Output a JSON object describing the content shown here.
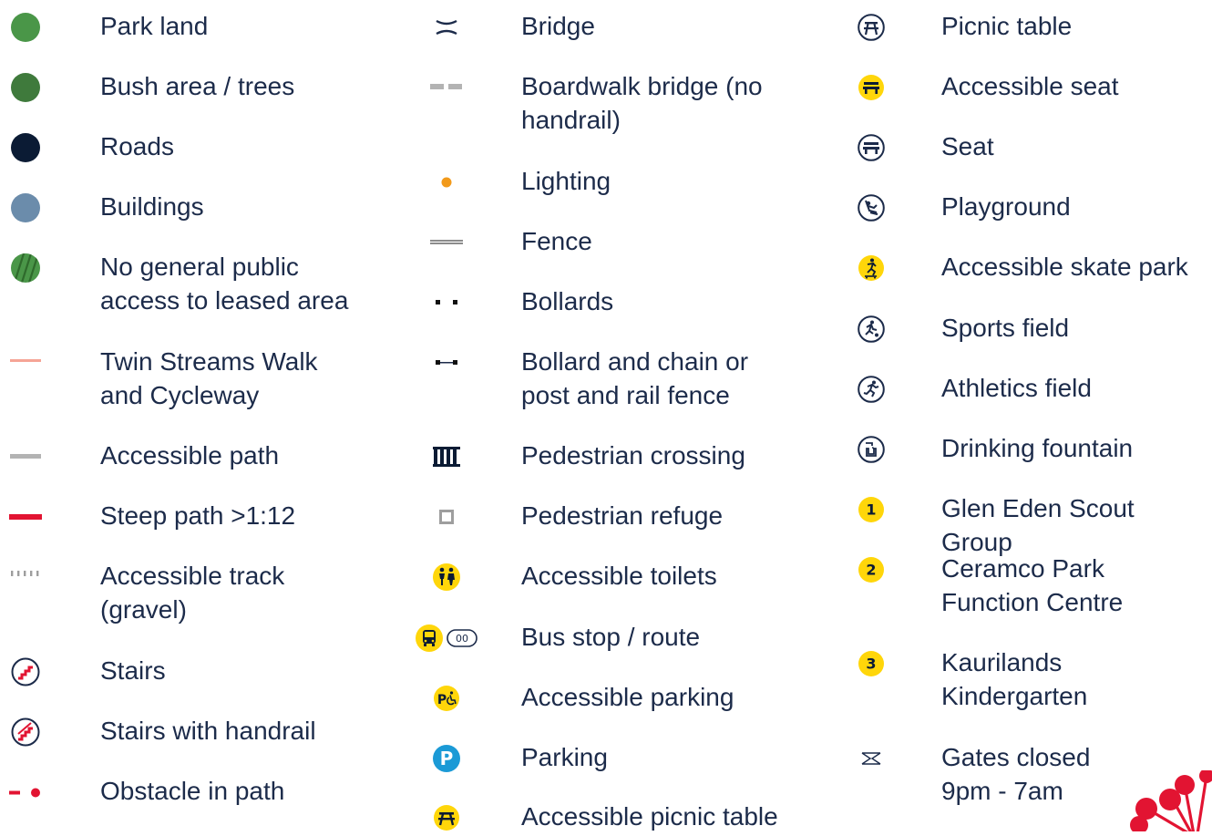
{
  "legend": {
    "columns": [
      {
        "items": [
          {
            "label": "Park land",
            "icon": "park-land-swatch",
            "color": "#4a9648"
          },
          {
            "label": "Bush area / trees",
            "icon": "bush-area-swatch",
            "color": "#3f7a3c"
          },
          {
            "label": "Roads",
            "icon": "roads-swatch",
            "color": "#0b1b34"
          },
          {
            "label": "Buildings",
            "icon": "buildings-swatch",
            "color": "#6b8cab"
          },
          {
            "label": "No general public\naccess to leased area",
            "icon": "leased-area-hatch-swatch",
            "color": "#3f8a3a"
          },
          {
            "label": "Twin Streams Walk\nand Cycleway",
            "icon": "cycleway-line",
            "color": "#f5a496"
          },
          {
            "label": "Accessible path",
            "icon": "accessible-path-line",
            "color": "#b3b3b3"
          },
          {
            "label": "Steep path >1:12",
            "icon": "steep-path-line",
            "color": "#e21432"
          },
          {
            "label": "Accessible track\n(gravel)",
            "icon": "gravel-track-line",
            "color": "#9e9e9e"
          },
          {
            "label": "Stairs",
            "icon": "stairs-icon",
            "color": "#e21432"
          },
          {
            "label": "Stairs with handrail",
            "icon": "stairs-handrail-icon",
            "color": "#e21432"
          },
          {
            "label": "Obstacle in path",
            "icon": "obstacle-icon",
            "color": "#e21432"
          }
        ]
      },
      {
        "items": [
          {
            "label": "Bridge",
            "icon": "bridge-icon",
            "color": "#1c2b4a"
          },
          {
            "label": "Boardwalk bridge (no\nhandrail)",
            "icon": "boardwalk-bridge-icon",
            "color": "#b3b3b3"
          },
          {
            "label": "Lighting",
            "icon": "lighting-dot",
            "color": "#f29a1a"
          },
          {
            "label": "Fence",
            "icon": "fence-line",
            "color": "#8c8c8c"
          },
          {
            "label": "Bollards",
            "icon": "bollards-icon",
            "color": "#111111"
          },
          {
            "label": "Bollard and chain or\npost and rail fence",
            "icon": "bollard-chain-icon",
            "color": "#1c2b4a"
          },
          {
            "label": "Pedestrian crossing",
            "icon": "pedestrian-crossing-icon",
            "color": "#0b1b34"
          },
          {
            "label": "Pedestrian refuge",
            "icon": "pedestrian-refuge-icon",
            "color": "#9e9e9e"
          },
          {
            "label": "Accessible toilets",
            "icon": "accessible-toilets-icon",
            "color": "#ffd60a"
          },
          {
            "label": "Bus stop / route",
            "icon": "bus-stop-icon",
            "color": "#ffd60a",
            "route_text": "00"
          },
          {
            "label": "Accessible parking",
            "icon": "accessible-parking-icon",
            "color": "#ffd60a",
            "badge_text": "P"
          },
          {
            "label": "Parking",
            "icon": "parking-icon",
            "color": "#1b9ad6",
            "badge_text": "P"
          },
          {
            "label": "Accessible picnic table",
            "icon": "accessible-picnic-table-icon",
            "color": "#ffd60a"
          }
        ]
      },
      {
        "items": [
          {
            "label": "Picnic table",
            "icon": "picnic-table-icon",
            "color": "#1c2b4a"
          },
          {
            "label": "Accessible seat",
            "icon": "accessible-seat-icon",
            "color": "#ffd60a"
          },
          {
            "label": "Seat",
            "icon": "seat-icon",
            "color": "#1c2b4a"
          },
          {
            "label": "Playground",
            "icon": "playground-icon",
            "color": "#1c2b4a"
          },
          {
            "label": "Accessible skate park",
            "icon": "accessible-skate-park-icon",
            "color": "#ffd60a"
          },
          {
            "label": "Sports field",
            "icon": "sports-field-icon",
            "color": "#1c2b4a"
          },
          {
            "label": "Athletics field",
            "icon": "athletics-field-icon",
            "color": "#1c2b4a"
          },
          {
            "label": "Drinking fountain",
            "icon": "drinking-fountain-icon",
            "color": "#1c2b4a"
          },
          {
            "label": "Glen Eden Scout Group",
            "icon": "number-badge-1",
            "color": "#ffd60a",
            "badge_text": "1"
          },
          {
            "label": "Ceramco Park\nFunction Centre",
            "icon": "number-badge-2",
            "color": "#ffd60a",
            "badge_text": "2"
          },
          {
            "label": "Kaurilands\nKindergarten",
            "icon": "number-badge-3",
            "color": "#ffd60a",
            "badge_text": "3"
          },
          {
            "label": "Gates closed\n9pm - 7am",
            "icon": "gates-closed-icon",
            "color": "#1c2b4a"
          }
        ]
      }
    ]
  },
  "brand": {
    "icon": "brand-logo-mark",
    "color": "#e21432"
  }
}
